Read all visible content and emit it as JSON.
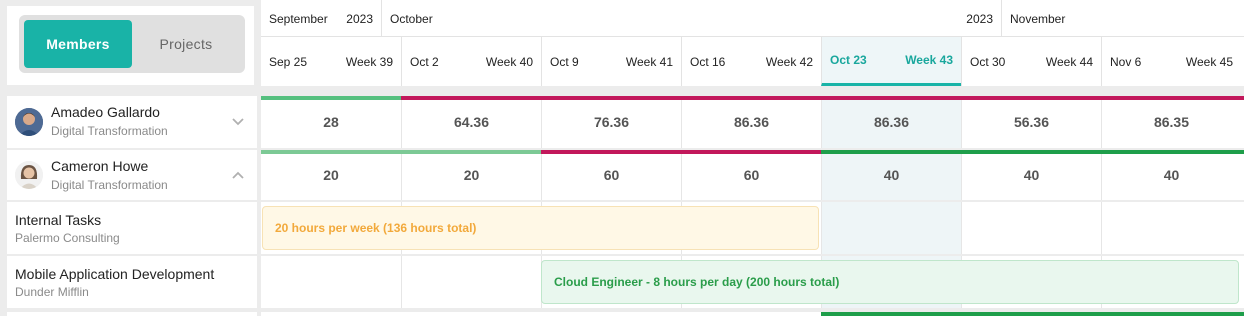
{
  "toggle": {
    "members": "Members",
    "projects": "Projects"
  },
  "header": {
    "months": [
      {
        "name": "September",
        "year": "2023"
      },
      {
        "name": "October",
        "year": "2023"
      },
      {
        "name": "November",
        "year": ""
      }
    ],
    "weeks": [
      {
        "date": "Sep 25",
        "week": "Week 39"
      },
      {
        "date": "Oct 2",
        "week": "Week 40"
      },
      {
        "date": "Oct 9",
        "week": "Week 41"
      },
      {
        "date": "Oct 16",
        "week": "Week 42"
      },
      {
        "date": "Oct 23",
        "week": "Week 43"
      },
      {
        "date": "Oct 30",
        "week": "Week 44"
      },
      {
        "date": "Nov 6",
        "week": "Week 45"
      }
    ]
  },
  "members": [
    {
      "name": "Amadeo Gallardo",
      "department": "Digital Transformation",
      "hours": [
        "28",
        "64.36",
        "76.36",
        "86.36",
        "86.36",
        "56.36",
        "86.35"
      ]
    },
    {
      "name": "Cameron Howe",
      "department": "Digital Transformation",
      "hours": [
        "20",
        "20",
        "60",
        "60",
        "40",
        "40",
        "40"
      ]
    }
  ],
  "projects": [
    {
      "name": "Internal Tasks",
      "client": "Palermo Consulting",
      "assignment": "20 hours per week (136 hours total)"
    },
    {
      "name": "Mobile Application Development",
      "client": "Dunder Mifflin",
      "assignment": "Cloud Engineer - 8 hours per day (200 hours total)"
    }
  ],
  "colors": {
    "accent": "#19b3a7",
    "under_allocated": "#55c07f",
    "over_allocated": "#c2185b",
    "on_target": "#1e9e4a",
    "internal_bg": "#fff8e6",
    "internal_text": "#f2a93b",
    "project_bg": "#e9f7ee",
    "project_text": "#2a9d4a"
  }
}
